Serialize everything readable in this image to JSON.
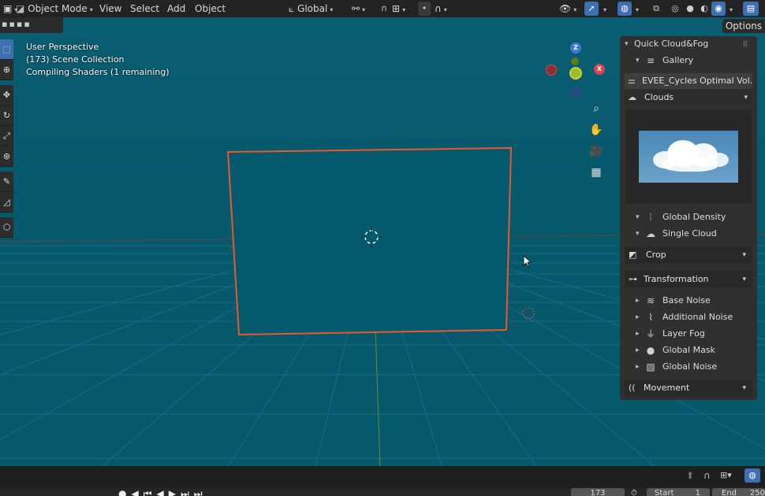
{
  "header": {
    "mode_label": "Object Mode",
    "menus": [
      "View",
      "Select",
      "Add",
      "Object"
    ],
    "transform_orientation": "Global",
    "options_label": "Options"
  },
  "viewport": {
    "info_lines": [
      "User Perspective",
      "(173) Scene Collection",
      "Compiling Shaders (1 remaining)"
    ]
  },
  "gizmo": {
    "axis_z": "Z",
    "axis_x": "X",
    "colors": {
      "x": "#d7454b",
      "y": "#9cbf22",
      "z": "#3f79c9"
    }
  },
  "npanel": {
    "title": "Quick Cloud&Fog",
    "gallery_label": "Gallery",
    "preset_value": "EVEE_Cycles Optimal Vol...",
    "clouds_label": "Clouds",
    "global_density_label": "Global Density",
    "single_cloud_label": "Single Cloud",
    "crop_label": "Crop",
    "transformation_label": "Transformation",
    "sub_items": [
      "Base Noise",
      "Additional Noise",
      "Layer Fog",
      "Global Mask",
      "Global Noise"
    ],
    "movement_label": "Movement"
  },
  "timeline": {
    "current_frame": "173",
    "start_label": "Start",
    "start_value": "1",
    "end_label": "End",
    "end_value": "250"
  },
  "colors": {
    "viewport_bg": "#06586b",
    "selection_outline": "#e8592c",
    "accent": "#3e6fb0"
  }
}
